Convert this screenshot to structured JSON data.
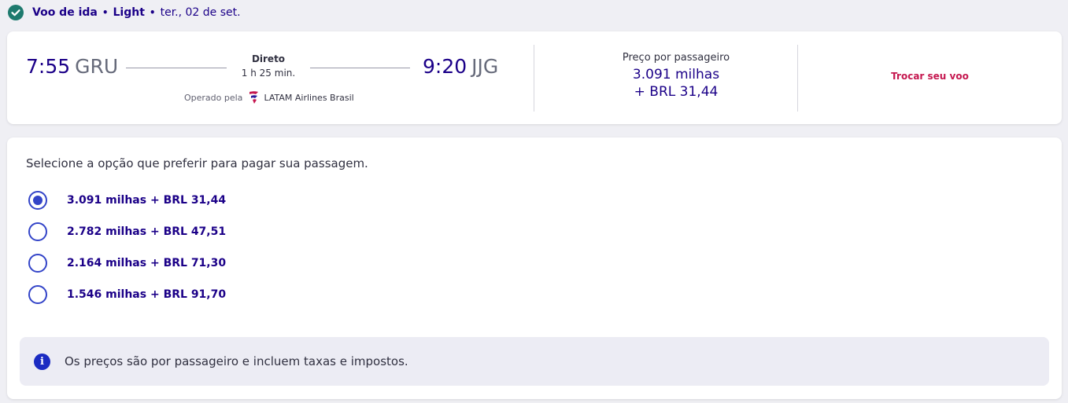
{
  "header": {
    "title": "Voo de ida",
    "separator": "•",
    "fare_class": "Light",
    "date": "ter., 02 de set."
  },
  "flight": {
    "departure_time": "7:55",
    "departure_code": "GRU",
    "arrival_time": "9:20",
    "arrival_code": "JJG",
    "stop_type": "Direto",
    "duration": "1 h 25 min.",
    "operated_label": "Operado pela",
    "airline": "LATAM Airlines Brasil"
  },
  "price": {
    "label": "Preço por passageiro",
    "miles": "3.091 milhas",
    "brl": "+ BRL 31,44"
  },
  "actions": {
    "change_flight": "Trocar seu voo"
  },
  "payment": {
    "instruction": "Selecione a opção que preferir para pagar sua passagem.",
    "selected_index": 0,
    "options": [
      {
        "label": "3.091 milhas + BRL 31,44",
        "selected": true
      },
      {
        "label": "2.782 milhas + BRL 47,51",
        "selected": false
      },
      {
        "label": "2.164 milhas + BRL 71,30",
        "selected": false
      },
      {
        "label": "1.546 milhas + BRL 91,70",
        "selected": false
      }
    ]
  },
  "info": {
    "text": "Os preços são por passageiro e incluem taxas e impostos.",
    "icon_glyph": "i"
  },
  "icons": {
    "header": "check-circle-icon",
    "airline": "latam-logo-icon",
    "info": "info-icon"
  },
  "colors": {
    "brand_navy": "#1b0088",
    "accent_red": "#c5174f",
    "radio_blue": "#3344c8",
    "check_teal": "#1e7a6e"
  }
}
